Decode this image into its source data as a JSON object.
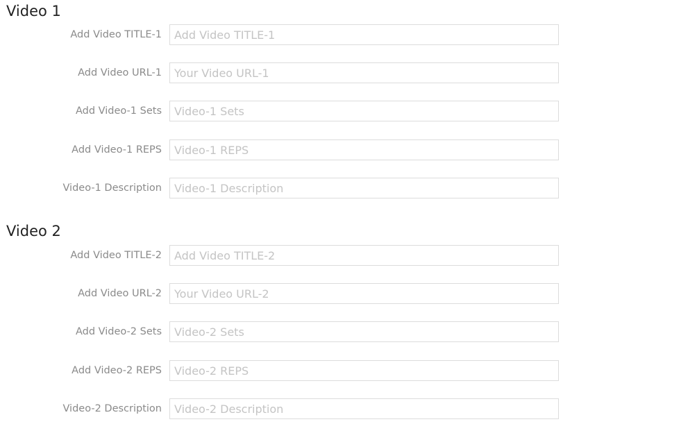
{
  "sections": [
    {
      "title": "Video 1",
      "fields": [
        {
          "label": "Add Video TITLE-1",
          "placeholder": "Add Video TITLE-1"
        },
        {
          "label": "Add Video URL-1",
          "placeholder": "Your Video URL-1"
        },
        {
          "label": "Add Video-1 Sets",
          "placeholder": "Video-1 Sets"
        },
        {
          "label": "Add Video-1 REPS",
          "placeholder": "Video-1 REPS"
        },
        {
          "label": "Video-1 Description",
          "placeholder": "Video-1 Description"
        }
      ]
    },
    {
      "title": "Video 2",
      "fields": [
        {
          "label": "Add Video TITLE-2",
          "placeholder": "Add Video TITLE-2"
        },
        {
          "label": "Add Video URL-2",
          "placeholder": "Your Video URL-2"
        },
        {
          "label": "Add Video-2 Sets",
          "placeholder": "Video-2 Sets"
        },
        {
          "label": "Add Video-2 REPS",
          "placeholder": "Video-2 REPS"
        },
        {
          "label": "Video-2 Description",
          "placeholder": "Video-2 Description"
        }
      ]
    }
  ]
}
